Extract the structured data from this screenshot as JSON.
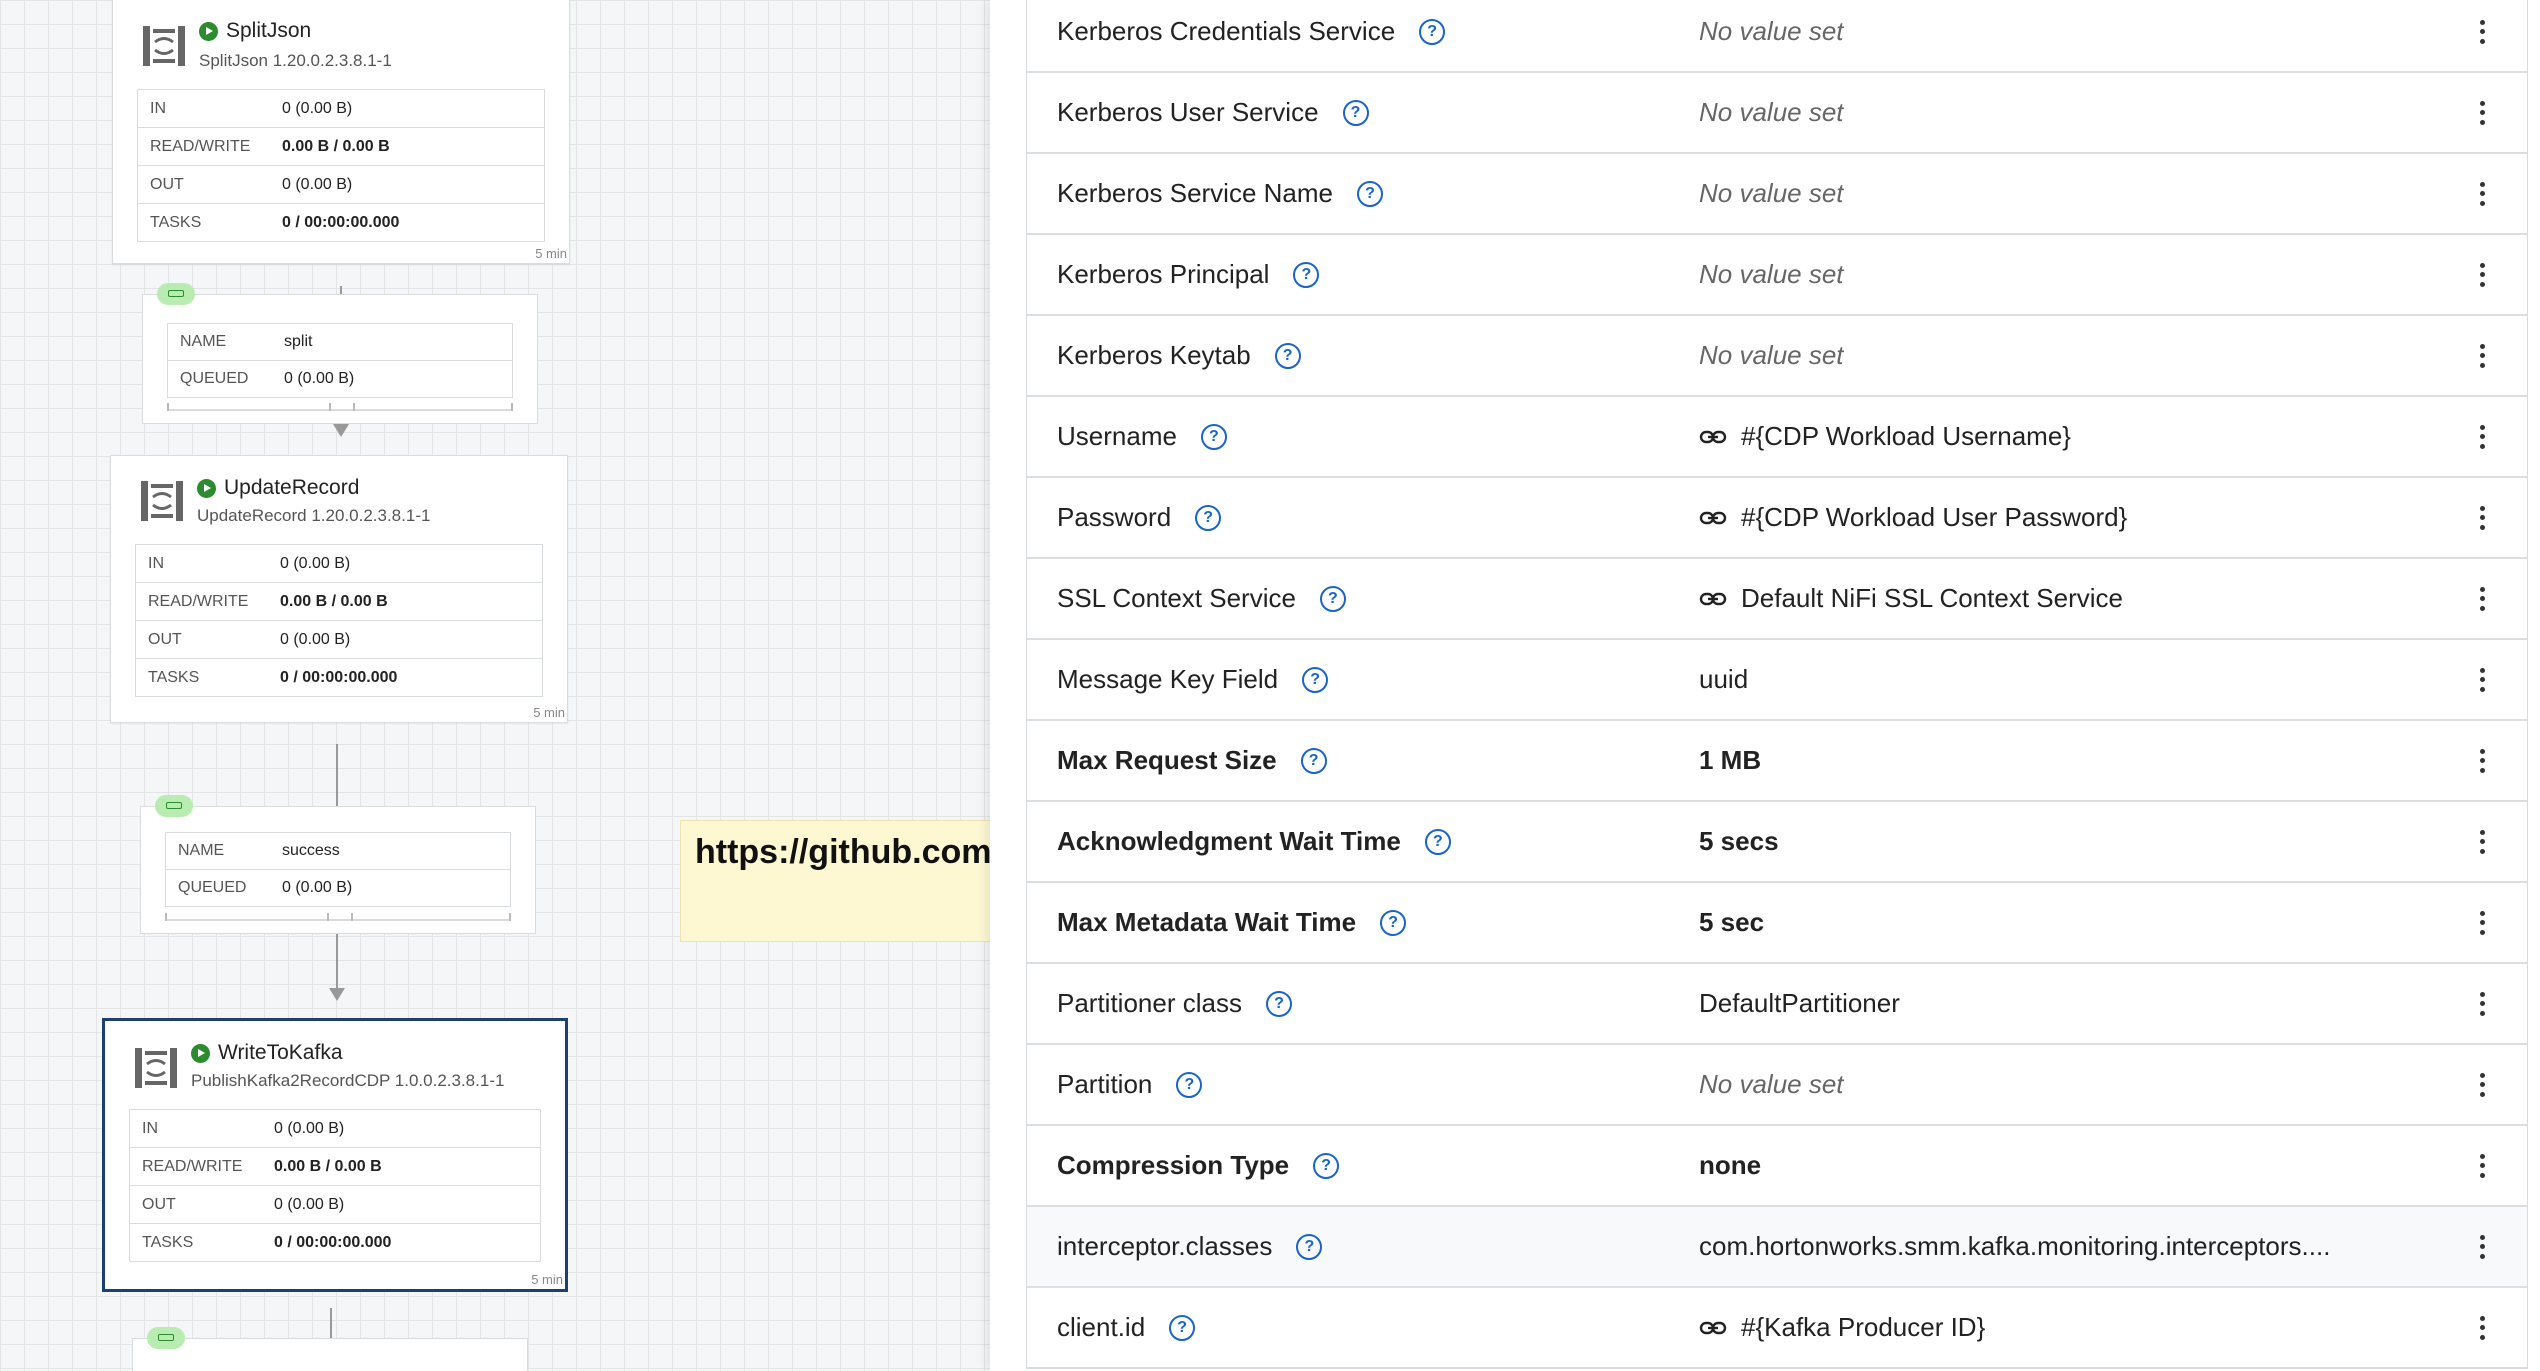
{
  "canvas": {
    "processors": [
      {
        "title": "SplitJson",
        "subtitle": "SplitJson 1.20.0.2.3.8.1-1",
        "stats": [
          {
            "label": "IN",
            "value": "0 (0.00 B)"
          },
          {
            "label": "READ/WRITE",
            "value": "0.00 B / 0.00 B"
          },
          {
            "label": "OUT",
            "value": "0 (0.00 B)"
          },
          {
            "label": "TASKS",
            "value": "0 / 00:00:00.000"
          }
        ],
        "age": "5 min"
      },
      {
        "title": "UpdateRecord",
        "subtitle": "UpdateRecord 1.20.0.2.3.8.1-1",
        "stats": [
          {
            "label": "IN",
            "value": "0 (0.00 B)"
          },
          {
            "label": "READ/WRITE",
            "value": "0.00 B / 0.00 B"
          },
          {
            "label": "OUT",
            "value": "0 (0.00 B)"
          },
          {
            "label": "TASKS",
            "value": "0 / 00:00:00.000"
          }
        ],
        "age": "5 min"
      },
      {
        "title": "WriteToKafka",
        "subtitle": "PublishKafka2RecordCDP 1.0.0.2.3.8.1-1",
        "stats": [
          {
            "label": "IN",
            "value": "0 (0.00 B)"
          },
          {
            "label": "READ/WRITE",
            "value": "0.00 B / 0.00 B"
          },
          {
            "label": "OUT",
            "value": "0 (0.00 B)"
          },
          {
            "label": "TASKS",
            "value": "0 / 00:00:00.000"
          }
        ],
        "age": "5 min"
      }
    ],
    "connections": [
      {
        "name_label": "NAME",
        "name": "split",
        "queued_label": "QUEUED",
        "queued": "0 (0.00 B)"
      },
      {
        "name_label": "NAME",
        "name": "success",
        "queued_label": "QUEUED",
        "queued": "0 (0.00 B)"
      }
    ],
    "label_note": "https://github.com"
  },
  "properties": [
    {
      "name": "Kerberos Credentials Service",
      "value": "No value set",
      "empty": true,
      "bold": false,
      "link": false
    },
    {
      "name": "Kerberos User Service",
      "value": "No value set",
      "empty": true,
      "bold": false,
      "link": false
    },
    {
      "name": "Kerberos Service Name",
      "value": "No value set",
      "empty": true,
      "bold": false,
      "link": false
    },
    {
      "name": "Kerberos Principal",
      "value": "No value set",
      "empty": true,
      "bold": false,
      "link": false
    },
    {
      "name": "Kerberos Keytab",
      "value": "No value set",
      "empty": true,
      "bold": false,
      "link": false
    },
    {
      "name": "Username",
      "value": "#{CDP Workload Username}",
      "empty": false,
      "bold": false,
      "link": true
    },
    {
      "name": "Password",
      "value": "#{CDP Workload User Password}",
      "empty": false,
      "bold": false,
      "link": true
    },
    {
      "name": "SSL Context Service",
      "value": "Default NiFi SSL Context Service",
      "empty": false,
      "bold": false,
      "link": true
    },
    {
      "name": "Message Key Field",
      "value": "uuid",
      "empty": false,
      "bold": false,
      "link": false
    },
    {
      "name": "Max Request Size",
      "value": "1 MB",
      "empty": false,
      "bold": true,
      "link": false
    },
    {
      "name": "Acknowledgment Wait Time",
      "value": "5 secs",
      "empty": false,
      "bold": true,
      "link": false
    },
    {
      "name": "Max Metadata Wait Time",
      "value": "5 sec",
      "empty": false,
      "bold": true,
      "link": false
    },
    {
      "name": "Partitioner class",
      "value": "DefaultPartitioner",
      "empty": false,
      "bold": false,
      "link": false
    },
    {
      "name": "Partition",
      "value": "No value set",
      "empty": true,
      "bold": false,
      "link": false
    },
    {
      "name": "Compression Type",
      "value": "none",
      "empty": false,
      "bold": true,
      "link": false
    },
    {
      "name": "interceptor.classes",
      "value": "com.hortonworks.smm.kafka.monitoring.interceptors....",
      "empty": false,
      "bold": false,
      "link": false,
      "highlight": true
    },
    {
      "name": "client.id",
      "value": "#{Kafka Producer ID}",
      "empty": false,
      "bold": false,
      "link": true
    }
  ],
  "colors": {
    "running": "#2c8a2f",
    "help": "#1a64c8",
    "selected_border": "#1d3f72",
    "queue_badge": "#b9ecb0",
    "note_background": "#fdf7d2"
  },
  "icons": {
    "processor": "processor-icon",
    "running": "running-icon",
    "help": "help-icon",
    "parameter_link": "link-icon",
    "menu": "kebab-icon",
    "queue": "queue-icon"
  }
}
